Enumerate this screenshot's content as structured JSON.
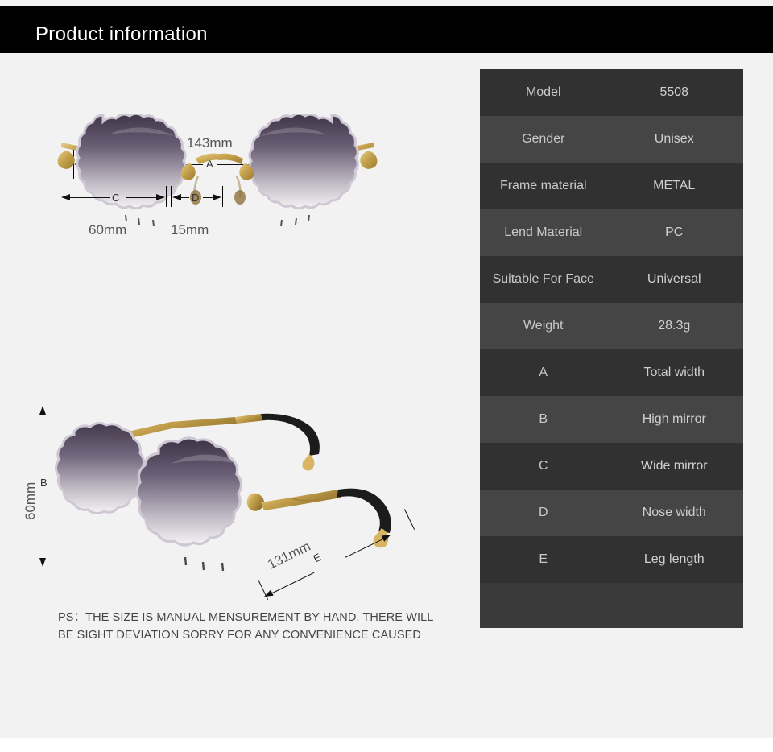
{
  "header": {
    "title": "Product information"
  },
  "diagram": {
    "front_view": {
      "alt": "front view of rimless scalloped sunglasses",
      "measurements": [
        {
          "letter": "A",
          "value": "143mm",
          "name": "total-width"
        },
        {
          "letter": "C",
          "value": "60mm",
          "name": "lens-width"
        },
        {
          "letter": "D",
          "value": "15mm",
          "name": "nose-width"
        }
      ]
    },
    "side_view": {
      "alt": "angled side view of rimless scalloped sunglasses",
      "measurements": [
        {
          "letter": "B",
          "value": "60mm",
          "name": "lens-height"
        },
        {
          "letter": "E",
          "value": "131mm",
          "name": "temple-length"
        }
      ]
    }
  },
  "note": {
    "line1": "PS：THE SIZE IS MANUAL MENSUREMENT BY HAND, THERE WILL",
    "line2": "BE SIGHT DEVIATION SORRY FOR ANY CONVENIENCE CAUSED"
  },
  "spec_table": {
    "rows": [
      {
        "key": "Model",
        "value": "5508"
      },
      {
        "key": "Gender",
        "value": "Unisex"
      },
      {
        "key": "Frame material",
        "value": "METAL"
      },
      {
        "key": "Lend Material",
        "value": "PC"
      },
      {
        "key": "Suitable For Face",
        "value": "Universal"
      },
      {
        "key": "Weight",
        "value": "28.3g"
      },
      {
        "key": "A",
        "value": "Total width"
      },
      {
        "key": "B",
        "value": "High mirror"
      },
      {
        "key": "C",
        "value": "Wide mirror"
      },
      {
        "key": "D",
        "value": "Nose width"
      },
      {
        "key": "E",
        "value": "Leg length"
      }
    ]
  },
  "colors": {
    "page_background": "#f2f2f2",
    "header_background": "#000000",
    "header_text": "#ffffff",
    "row_dark": "#313131",
    "row_light": "#454545",
    "row_text": "#c9c9c9",
    "lens_top": "#4a3f54",
    "metal_gold": "#c9a24a"
  }
}
